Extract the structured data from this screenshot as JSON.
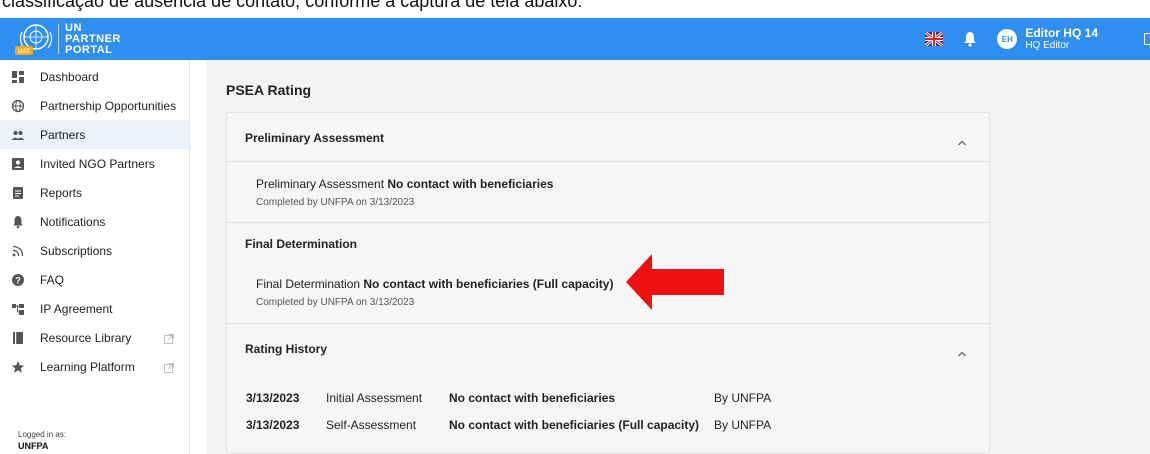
{
  "caption": "classificação de ausência de contato, conforme a captura de tela abaixo:",
  "app": {
    "logo_lines": [
      "UN",
      "PARTNER",
      "PORTAL"
    ],
    "emblem_badge": "UAT",
    "user_initials": "EH",
    "user_name": "Editor HQ 14",
    "user_role": "HQ Editor",
    "icons": [
      "un-emblem-icon",
      "uk-flag-icon",
      "bell-icon",
      "exit-icon"
    ]
  },
  "sidebar": {
    "items": [
      {
        "label": "Dashboard",
        "icon": "dashboard-icon",
        "active": false,
        "external": false
      },
      {
        "label": "Partnership Opportunities",
        "icon": "globe-icon",
        "active": false,
        "external": false
      },
      {
        "label": "Partners",
        "icon": "people-icon",
        "active": true,
        "external": false
      },
      {
        "label": "Invited NGO Partners",
        "icon": "person-box-icon",
        "active": false,
        "external": false
      },
      {
        "label": "Reports",
        "icon": "report-icon",
        "active": false,
        "external": false
      },
      {
        "label": "Notifications",
        "icon": "bell-icon",
        "active": false,
        "external": false
      },
      {
        "label": "Subscriptions",
        "icon": "rss-icon",
        "active": false,
        "external": false
      },
      {
        "label": "FAQ",
        "icon": "help-icon",
        "active": false,
        "external": false
      },
      {
        "label": "IP Agreement",
        "icon": "agreement-icon",
        "active": false,
        "external": false
      },
      {
        "label": "Resource Library",
        "icon": "book-icon",
        "active": false,
        "external": true
      },
      {
        "label": "Learning Platform",
        "icon": "star-icon",
        "active": false,
        "external": true
      }
    ],
    "logged_in_label": "Logged in as:",
    "logged_in_org": "UNFPA"
  },
  "main": {
    "title": "PSEA Rating",
    "preliminary": {
      "header": "Preliminary Assessment",
      "prefix": "Preliminary Assessment",
      "value": "No contact with beneficiaries",
      "completed": "Completed by UNFPA on 3/13/2023"
    },
    "final": {
      "header": "Final Determination",
      "prefix": "Final Determination",
      "value": "No contact with beneficiaries (Full capacity)",
      "completed": "Completed by UNFPA on 3/13/2023"
    },
    "history": {
      "header": "Rating History",
      "rows": [
        {
          "date": "3/13/2023",
          "type": "Initial Assessment",
          "rating": "No contact with beneficiaries",
          "by": "By UNFPA"
        },
        {
          "date": "3/13/2023",
          "type": "Self-Assessment",
          "rating": "No contact with beneficiaries (Full capacity)",
          "by": "By UNFPA"
        }
      ]
    }
  },
  "colors": {
    "appbar": "#2e8ff0",
    "arrow": "#ee1111",
    "active_nav": "#edf2fa"
  }
}
